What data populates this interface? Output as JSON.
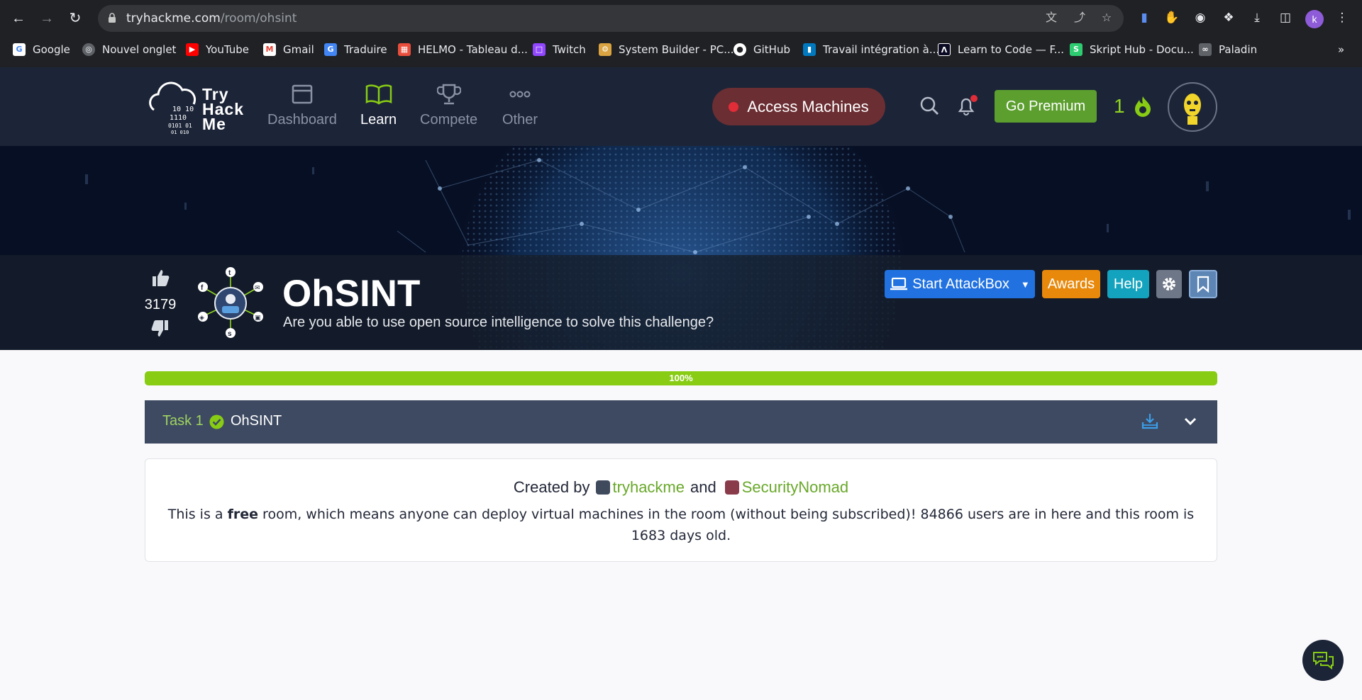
{
  "browser": {
    "url_host": "tryhackme.com",
    "url_path": "/room/ohsint",
    "profile_initial": "k",
    "bookmarks": [
      {
        "label": "Google",
        "icon": "google-icon",
        "color": "#ffffff"
      },
      {
        "label": "Nouvel onglet",
        "icon": "globe-icon",
        "color": "#9aa0a6"
      },
      {
        "label": "YouTube",
        "icon": "youtube-icon",
        "color": "#ff0000"
      },
      {
        "label": "Gmail",
        "icon": "gmail-icon",
        "color": "#ea4335"
      },
      {
        "label": "Traduire",
        "icon": "translate-icon",
        "color": "#4285f4"
      },
      {
        "label": "HELMO - Tableau d...",
        "icon": "helmo-icon",
        "color": "#e94e3c"
      },
      {
        "label": "Twitch",
        "icon": "twitch-icon",
        "color": "#9146ff"
      },
      {
        "label": "System Builder - PC...",
        "icon": "pcpart-icon",
        "color": "#d9a441"
      },
      {
        "label": "GitHub",
        "icon": "github-icon",
        "color": "#ffffff"
      },
      {
        "label": "Travail intégration à...",
        "icon": "trello-icon",
        "color": "#0079bf"
      },
      {
        "label": "Learn to Code — F...",
        "icon": "freecodecamp-icon",
        "color": "#ffffff"
      },
      {
        "label": "Skript Hub - Docu...",
        "icon": "skripthub-icon",
        "color": "#2ecc71"
      },
      {
        "label": "Paladin",
        "icon": "paladin-icon",
        "color": "#9aa0a6"
      }
    ],
    "more_bookmarks": "»"
  },
  "nav": {
    "logo_text": "Try\nHack\nMe",
    "items": [
      {
        "label": "Dashboard",
        "icon": "dashboard-icon",
        "active": false
      },
      {
        "label": "Learn",
        "icon": "book-icon",
        "active": true
      },
      {
        "label": "Compete",
        "icon": "trophy-icon",
        "active": false
      },
      {
        "label": "Other",
        "icon": "more-dots-icon",
        "active": false
      }
    ],
    "access_machines": "Access Machines",
    "go_premium": "Go Premium",
    "streak": "1"
  },
  "room": {
    "upvotes": "3179",
    "title": "OhSINT",
    "description": "Are you able to use open source intelligence to solve this challenge?",
    "buttons": {
      "start_attackbox": "Start AttackBox",
      "awards": "Awards",
      "help": "Help"
    },
    "progress": "100%",
    "progress_value": 100
  },
  "task": {
    "number": "Task 1",
    "name": "OhSINT"
  },
  "info": {
    "created_by": "Created by",
    "author1": "tryhackme",
    "and": "and",
    "author2": "SecurityNomad",
    "text_before": "This is a",
    "free": "free",
    "text_after": "room, which means anyone can deploy virtual machines in the room (without being subscribed)! 84866 users are in here and this room is 1683 days old."
  },
  "colors": {
    "brand_green": "#88cc14",
    "nav_bg": "#1c2538",
    "task_bg": "#3d4a62",
    "attackbox_blue": "#2172e0",
    "awards_orange": "#e8890c",
    "help_teal": "#14a3be"
  }
}
